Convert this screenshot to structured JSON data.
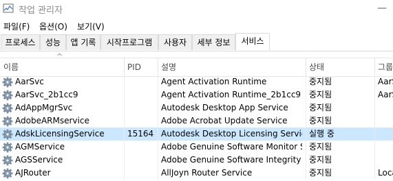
{
  "window": {
    "title": "작업 관리자"
  },
  "menu": {
    "file": "파일(F)",
    "options": "옵션(O)",
    "view": "보기(V)"
  },
  "tabs": [
    "프로세스",
    "성능",
    "앱 기록",
    "시작프로그램",
    "사용자",
    "세부 정보",
    "서비스"
  ],
  "columns": {
    "name": "이름",
    "pid": "PID",
    "description": "설명",
    "status": "상태",
    "group": "그룹"
  },
  "services": [
    {
      "name": "AarSvc",
      "pid": "",
      "description": "Agent Activation Runtime",
      "status": "중지됨",
      "group": "AarSv"
    },
    {
      "name": "AarSvc_2b1cc9",
      "pid": "",
      "description": "Agent Activation Runtime_2b1cc9",
      "status": "중지됨",
      "group": "AarSv"
    },
    {
      "name": "AdAppMgrSvc",
      "pid": "",
      "description": "Autodesk Desktop App Service",
      "status": "중지됨",
      "group": ""
    },
    {
      "name": "AdobeARMservice",
      "pid": "",
      "description": "Adobe Acrobat Update Service",
      "status": "중지됨",
      "group": ""
    },
    {
      "name": "AdskLicensingService",
      "pid": "15164",
      "description": "Autodesk Desktop Licensing Service",
      "status": "실행 중",
      "group": ""
    },
    {
      "name": "AGMService",
      "pid": "",
      "description": "Adobe Genuine Software Monitor S...",
      "status": "중지됨",
      "group": ""
    },
    {
      "name": "AGSService",
      "pid": "",
      "description": "Adobe Genuine Software Integrity S...",
      "status": "중지됨",
      "group": ""
    },
    {
      "name": "AJRouter",
      "pid": "",
      "description": "AllJoyn Router Service",
      "status": "중지됨",
      "group": "Loca"
    }
  ],
  "selected_row": 4,
  "colors": {
    "selection": "#cce8ff",
    "title_text": "#8a8a8a"
  }
}
